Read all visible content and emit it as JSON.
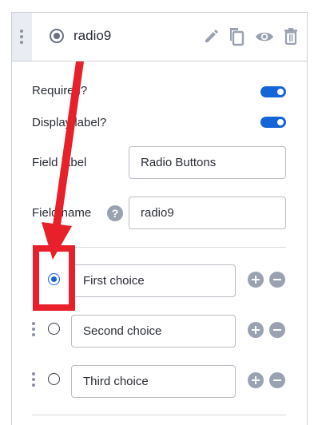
{
  "header": {
    "title": "radio9",
    "icons": [
      "drag-handle-icon",
      "radio-field-icon",
      "pencil-icon",
      "duplicate-icon",
      "eye-icon",
      "trash-icon"
    ]
  },
  "settings": {
    "required_label": "Required?",
    "required_on": true,
    "display_label": "Display label?",
    "display_on": true,
    "field_label_label": "Field label",
    "field_label_value": "Radio Buttons",
    "field_name_label": "Field name",
    "field_name_value": "radio9",
    "help_glyph": "?"
  },
  "choices": [
    {
      "value": "First choice",
      "checked": true
    },
    {
      "value": "Second choice",
      "checked": false
    },
    {
      "value": "Third choice",
      "checked": false
    }
  ],
  "colors": {
    "accent": "#1565d8",
    "annotation": "#e8202a",
    "icon_gray": "#9aa1b1"
  }
}
